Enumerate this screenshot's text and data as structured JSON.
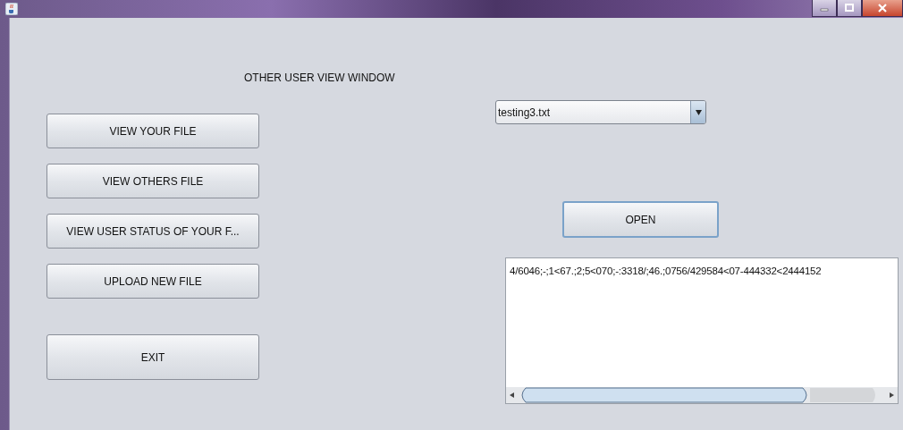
{
  "window": {
    "heading": "OTHER USER VIEW WINDOW"
  },
  "menu_buttons": [
    {
      "label": "VIEW YOUR FILE",
      "kind": "normal"
    },
    {
      "label": "VIEW OTHERS FILE",
      "kind": "normal"
    },
    {
      "label": "VIEW USER STATUS OF YOUR F...",
      "kind": "normal"
    },
    {
      "label": "UPLOAD NEW FILE",
      "kind": "normal"
    },
    {
      "label": "EXIT",
      "kind": "exit"
    }
  ],
  "file_select": {
    "value": "testing3.txt"
  },
  "open_button": {
    "label": "OPEN"
  },
  "file_content": {
    "text": "4/6046;-;1<67.;2;5<070;-:3318/;46.;0756/429584<07-444332<2444152"
  }
}
